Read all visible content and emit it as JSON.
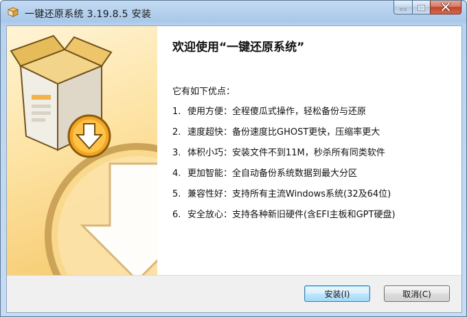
{
  "window": {
    "title": "一键还原系统 3.19.8.5 安装"
  },
  "colors": {
    "accent": "#f6c86a",
    "banner_dark": "#c98a1b",
    "titlebar": "#a9c8ea"
  },
  "icons": {
    "app": "installer-box-icon",
    "minimize": "minimize-icon",
    "maximize": "maximize-icon",
    "close": "close-icon",
    "banner_box": "open-box-icon",
    "banner_download": "download-arrow-icon"
  },
  "content": {
    "welcome": "欢迎使用“一键还原系统”",
    "intro": "它有如下优点：",
    "features": [
      {
        "num": "1.",
        "text": "使用方便：全程傻瓜式操作，轻松备份与还原"
      },
      {
        "num": "2.",
        "text": "速度超快：备份速度比GHOST更快，压缩率更大"
      },
      {
        "num": "3.",
        "text": "体积小巧：安装文件不到11M，秒杀所有同类软件"
      },
      {
        "num": "4.",
        "text": "更加智能：全自动备份系统数据到最大分区"
      },
      {
        "num": "5.",
        "text": "兼容性好：支持所有主流Windows系统(32及64位)"
      },
      {
        "num": "6.",
        "text": "安全放心：支持各种新旧硬件(含EFI主板和GPT硬盘)"
      }
    ]
  },
  "footer": {
    "install_label": "安装(I)",
    "cancel_label": "取消(C)"
  }
}
